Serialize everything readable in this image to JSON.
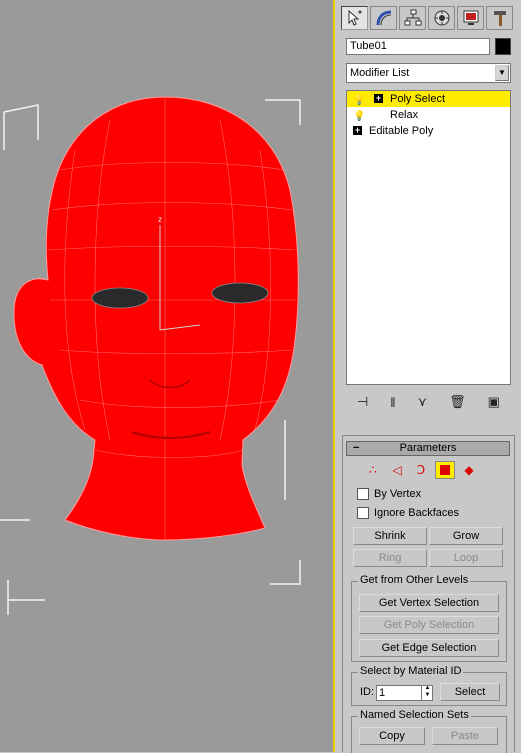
{
  "viewport": {
    "label": "Perspective viewport - red head mesh"
  },
  "command_panel": {
    "tabs": [
      {
        "name": "create",
        "icon": "create-arrow-icon"
      },
      {
        "name": "modify",
        "icon": "modify-bend-icon"
      },
      {
        "name": "hierarchy",
        "icon": "hierarchy-icon"
      },
      {
        "name": "motion",
        "icon": "motion-icon"
      },
      {
        "name": "display",
        "icon": "display-monitor-icon"
      },
      {
        "name": "utilities",
        "icon": "utilities-hammer-icon"
      }
    ],
    "object_name": "Tube01",
    "object_color": "#000000",
    "modifier_list_label": "Modifier List",
    "stack": [
      {
        "label": "Poly Select",
        "selected": true
      },
      {
        "label": "Relax",
        "selected": false
      },
      {
        "label": "Editable Poly",
        "selected": false
      }
    ]
  },
  "parameters": {
    "title": "Parameters",
    "by_vertex": "By Vertex",
    "ignore_backfaces": "Ignore Backfaces",
    "shrink": "Shrink",
    "grow": "Grow",
    "ring": "Ring",
    "loop": "Loop",
    "get_from_other_levels": "Get from Other Levels",
    "get_vertex_selection": "Get Vertex Selection",
    "get_poly_selection": "Get Poly Selection",
    "get_edge_selection": "Get Edge Selection",
    "select_by_material_id": "Select by Material ID",
    "id_label": "ID:",
    "id_value": "1",
    "select": "Select",
    "named_selection_sets": "Named Selection Sets",
    "copy": "Copy",
    "paste": "Paste"
  },
  "colors": {
    "accent": "#ffeb00",
    "mesh": "#ff0000",
    "viewport_bg": "#9a9a9a"
  }
}
